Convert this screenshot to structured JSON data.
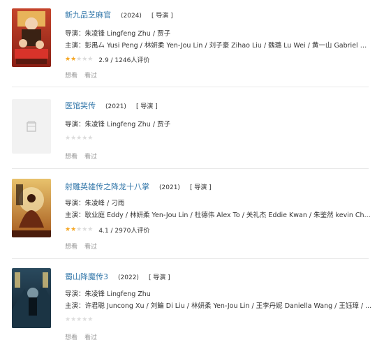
{
  "items": [
    {
      "title": "新九品芝麻官",
      "year": "(2024)",
      "role": "[ 导演 ]",
      "director_label": "导演：",
      "directors": "朱凌锋 Lingfeng Zhu / 贾子",
      "cast_label": "主演：",
      "cast": "彭禺厶 Yusi Peng / 林妍柔 Yen-Jou Lin / 刘子豪 Zihao Liu / 魏璐 Lu Wei / 黄一山 Gabriel W...",
      "rating_text": "2.9 / 1246人评价",
      "rating_stars": 1.5,
      "wish": "想看",
      "seen": "看过",
      "poster_icon": "poster-image"
    },
    {
      "title": "医馆笑传",
      "year": "(2021)",
      "role": "[ 导演 ]",
      "director_label": "导演：",
      "directors": "朱凌锋 Lingfeng Zhu / 贾子",
      "cast_label": "",
      "cast": "",
      "rating_text": "",
      "rating_stars": 0,
      "wish": "想看",
      "seen": "看过",
      "poster_icon": "placeholder-poster-icon"
    },
    {
      "title": "射雕英雄传之降龙十八掌",
      "year": "(2021)",
      "role": "[ 导演 ]",
      "director_label": "导演：",
      "directors": "朱凌峰 / 刁雨",
      "cast_label": "主演：",
      "cast": "耿业庭 Eddy / 林妍柔 Yen-Jou Lin / 杜德伟 Alex To / 关礼杰 Eddie Kwan / 朱鉴然 kevin Ch...",
      "rating_text": "4.1 / 2970人评价",
      "rating_stars": 2,
      "wish": "想看",
      "seen": "看过",
      "poster_icon": "poster-image"
    },
    {
      "title": "蜀山降魔传3",
      "year": "(2022)",
      "role": "[ 导演 ]",
      "director_label": "导演：",
      "directors": "朱凌锋 Lingfeng Zhu",
      "cast_label": "主演：",
      "cast": "许君聪 Juncong Xu / 刘鳊 Di Liu / 林妍柔 Yen-Jou Lin / 王李丹妮 Daniella Wang / 王钰璋 / ...",
      "rating_text": "",
      "rating_stars": 0,
      "wish": "想看",
      "seen": "看过",
      "poster_icon": "poster-image"
    }
  ],
  "colors": {
    "link": "#3377aa",
    "star": "#f5a623",
    "star_empty": "#dcdcdc",
    "muted": "#999999"
  }
}
